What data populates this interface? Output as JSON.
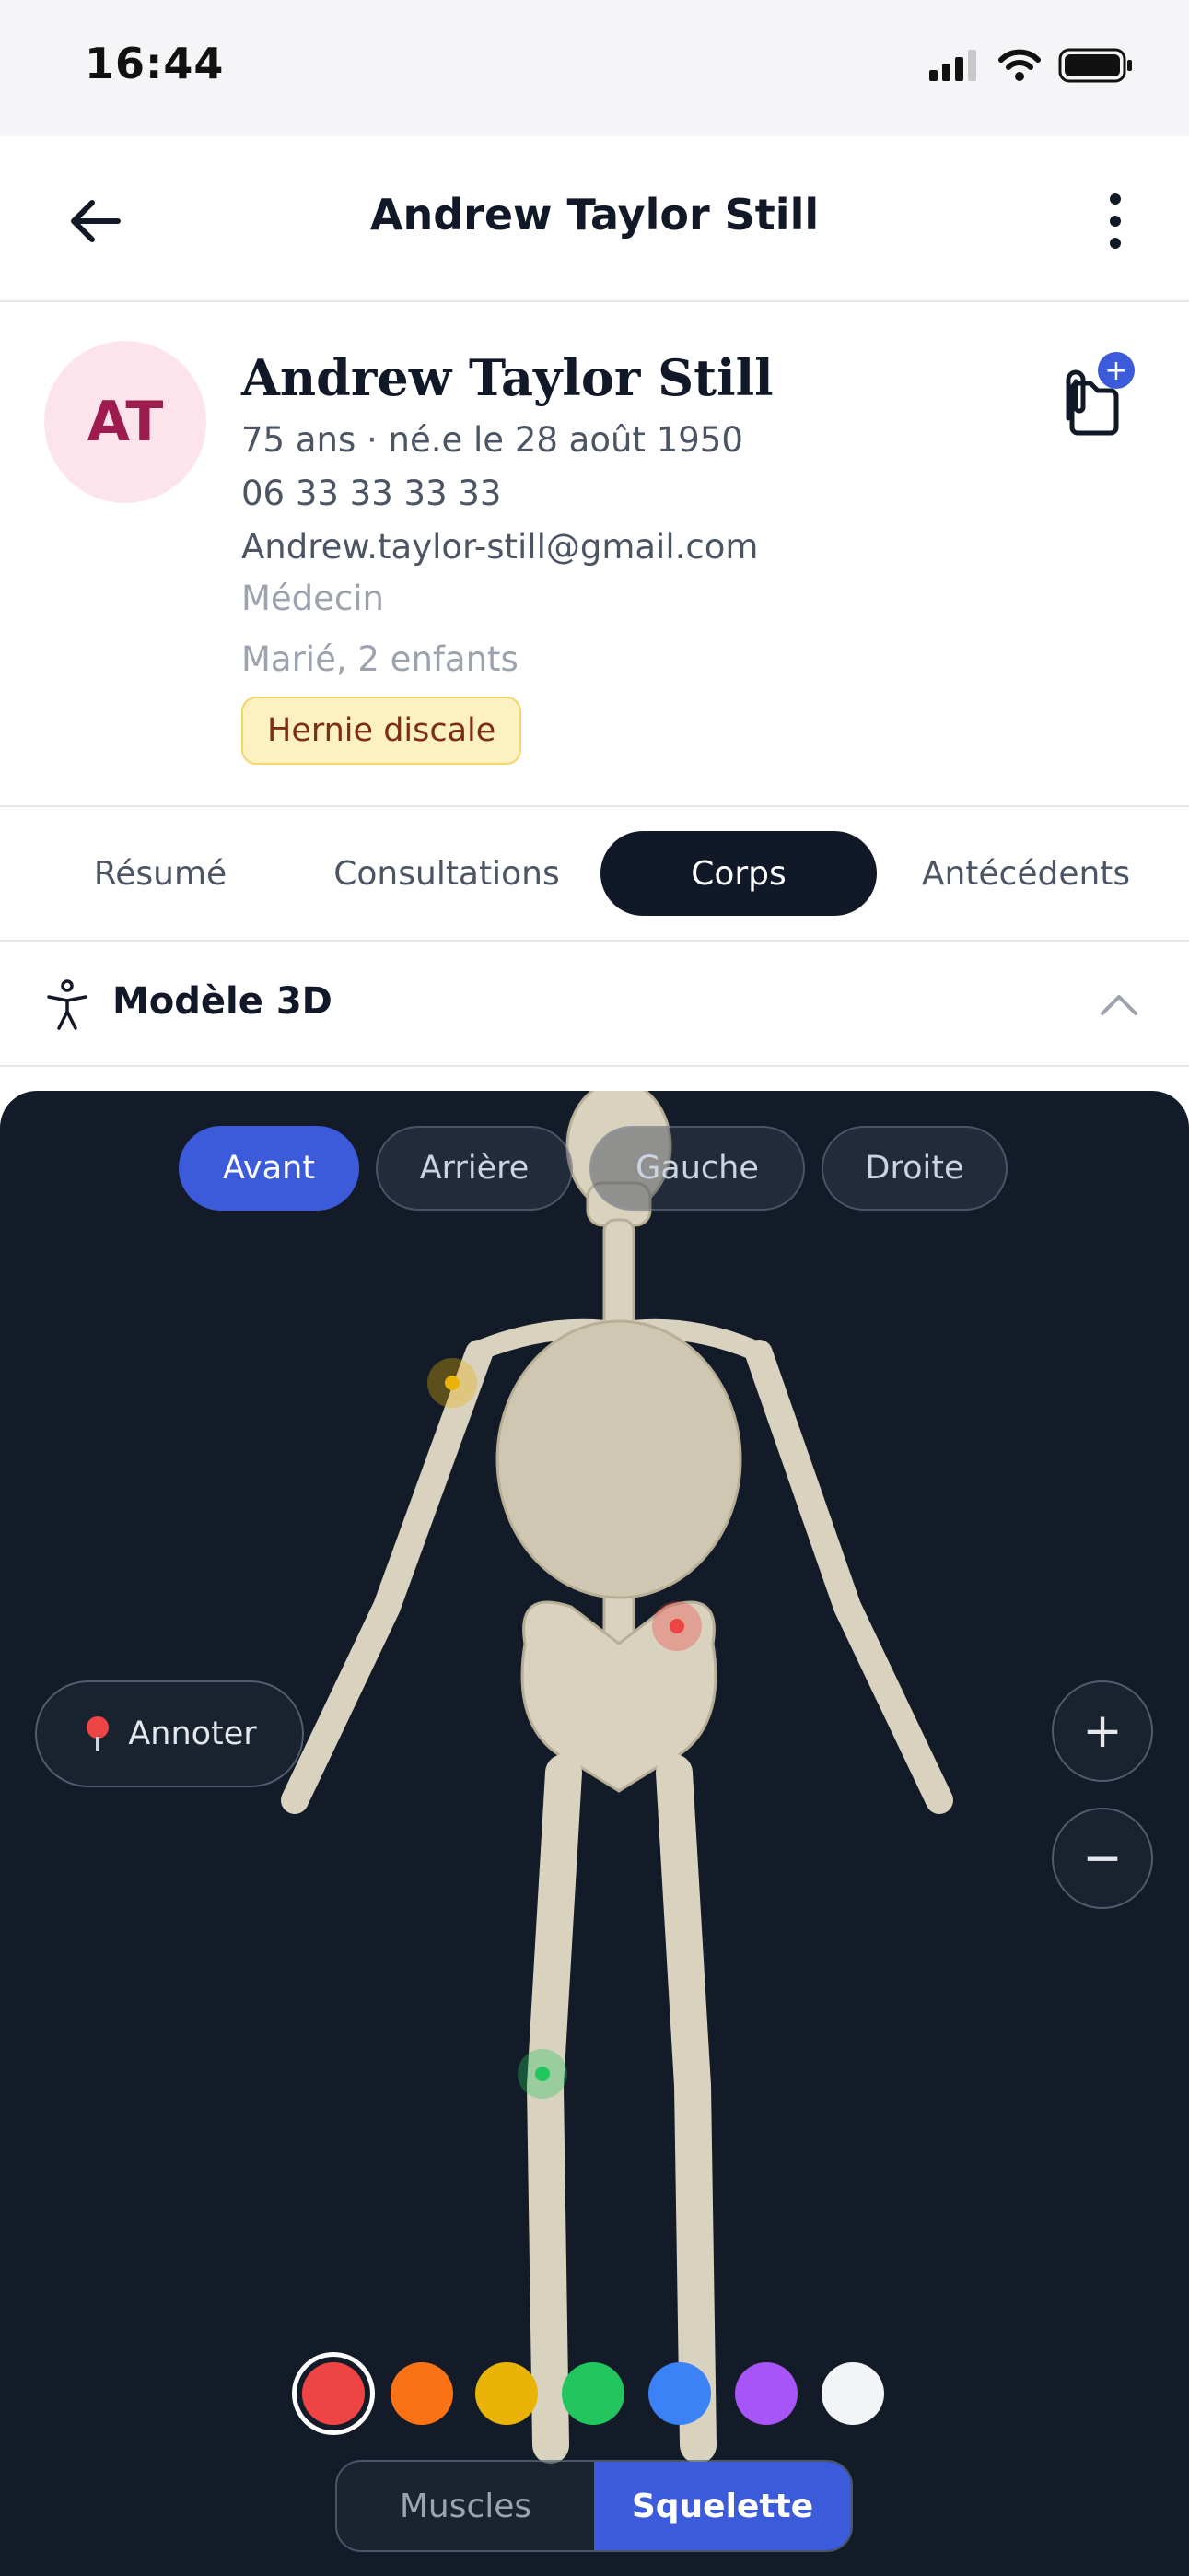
{
  "status_bar": {
    "time": "16:44"
  },
  "header": {
    "title": "Andrew Taylor Still"
  },
  "patient": {
    "initials": "AT",
    "name": "Andrew Taylor Still",
    "age_line": "75 ans · né.e le 28 août 1950",
    "phone": "06 33 33 33 33",
    "email": "Andrew.taylor-still@gmail.com",
    "profession": "Médecin",
    "family": "Marié, 2 enfants",
    "tag": "Hernie discale",
    "docs_badge": "+"
  },
  "tabs": [
    {
      "label": "Résumé",
      "active": false
    },
    {
      "label": "Consultations",
      "active": false
    },
    {
      "label": "Corps",
      "active": true
    },
    {
      "label": "Antécédents",
      "active": false
    }
  ],
  "section": {
    "title": "Modèle 3D"
  },
  "viewer": {
    "views": [
      {
        "label": "Avant",
        "active": true
      },
      {
        "label": "Arrière",
        "active": false
      },
      {
        "label": "Gauche",
        "active": false
      },
      {
        "label": "Droite",
        "active": false
      }
    ],
    "annotate_label": "Annoter",
    "zoom_in": "+",
    "zoom_out": "−",
    "palette": [
      {
        "color": "#ef4444",
        "selected": true
      },
      {
        "color": "#f97316",
        "selected": false
      },
      {
        "color": "#eab308",
        "selected": false
      },
      {
        "color": "#22c55e",
        "selected": false
      },
      {
        "color": "#3b82f6",
        "selected": false
      },
      {
        "color": "#a855f7",
        "selected": false
      },
      {
        "color": "#f3f4f6",
        "selected": false
      }
    ],
    "modes": [
      {
        "label": "Muscles",
        "active": false
      },
      {
        "label": "Squelette",
        "active": true
      }
    ],
    "markers": [
      {
        "name": "shoulder",
        "color": "#eab308"
      },
      {
        "name": "lumbar",
        "color": "#ef4444"
      },
      {
        "name": "knee",
        "color": "#22c55e"
      }
    ]
  }
}
